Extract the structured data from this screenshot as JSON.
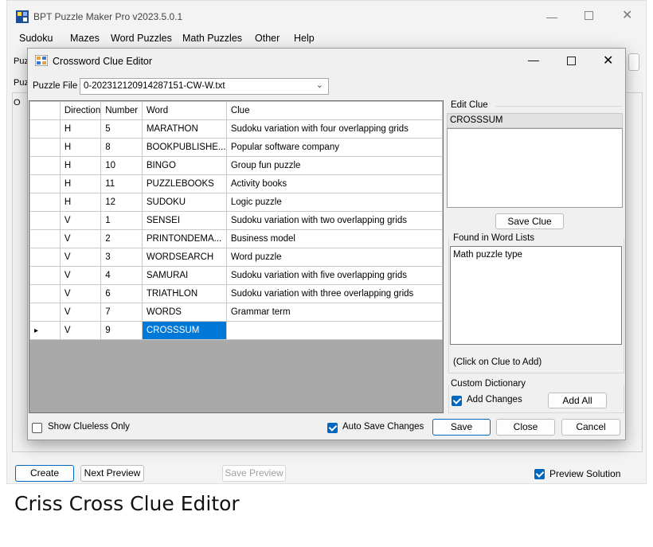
{
  "app": {
    "title": "BPT Puzzle Maker Pro v2023.5.0.1",
    "menu": [
      "Sudoku",
      "Mazes",
      "Word Puzzles",
      "Math Puzzles",
      "Other",
      "Help"
    ],
    "bg_label_1": "Puz",
    "bg_label_2": "Puz",
    "bg_label_3": "O",
    "bottom": {
      "create": "Create",
      "next_preview": "Next Preview",
      "save_preview": "Save Preview",
      "preview_solution": "Preview Solution",
      "preview_solution_checked": true
    }
  },
  "dialog": {
    "title": "Crossword Clue Editor",
    "puzzle_file_label": "Puzzle File",
    "puzzle_file_value": "0-202312120914287151-CW-W.txt",
    "columns": [
      "",
      "Direction",
      "Number",
      "Word",
      "Clue"
    ],
    "rows": [
      {
        "indicator": "",
        "direction": "H",
        "number": "5",
        "word": "MARATHON",
        "clue": "Sudoku variation with four overlapping grids"
      },
      {
        "indicator": "",
        "direction": "H",
        "number": "8",
        "word": "BOOKPUBLISHE...",
        "clue": "Popular software company"
      },
      {
        "indicator": "",
        "direction": "H",
        "number": "10",
        "word": "BINGO",
        "clue": "Group fun puzzle"
      },
      {
        "indicator": "",
        "direction": "H",
        "number": "11",
        "word": "PUZZLEBOOKS",
        "clue": "Activity books"
      },
      {
        "indicator": "",
        "direction": "H",
        "number": "12",
        "word": "SUDOKU",
        "clue": "Logic puzzle"
      },
      {
        "indicator": "",
        "direction": "V",
        "number": "1",
        "word": "SENSEI",
        "clue": "Sudoku variation with two overlapping grids"
      },
      {
        "indicator": "",
        "direction": "V",
        "number": "2",
        "word": "PRINTONDEMA...",
        "clue": "Business model"
      },
      {
        "indicator": "",
        "direction": "V",
        "number": "3",
        "word": "WORDSEARCH",
        "clue": "Word puzzle"
      },
      {
        "indicator": "",
        "direction": "V",
        "number": "4",
        "word": "SAMURAI",
        "clue": "Sudoku variation with five overlapping grids"
      },
      {
        "indicator": "",
        "direction": "V",
        "number": "6",
        "word": "TRIATHLON",
        "clue": "Sudoku variation with three overlapping grids"
      },
      {
        "indicator": "",
        "direction": "V",
        "number": "7",
        "word": "WORDS",
        "clue": "Grammar term"
      },
      {
        "indicator": "▸",
        "direction": "V",
        "number": "9",
        "word": "CROSSSUM",
        "clue": ""
      }
    ],
    "edit_clue_label": "Edit Clue",
    "edit_clue_word": "CROSSSUM",
    "edit_clue_text": "",
    "save_clue": "Save Clue",
    "found_label": "Found in Word Lists",
    "found_items": [
      "Math puzzle type"
    ],
    "click_hint": "(Click on Clue to Add)",
    "custom_dict_label": "Custom Dictionary",
    "add_changes": "Add Changes",
    "add_changes_checked": true,
    "add_all": "Add All",
    "show_clueless": "Show Clueless Only",
    "show_clueless_checked": false,
    "auto_save": "Auto Save Changes",
    "auto_save_checked": true,
    "save": "Save",
    "close": "Close",
    "cancel": "Cancel"
  },
  "caption": "Criss Cross Clue Editor",
  "colors": {
    "accent": "#0067c0",
    "selection": "#0078d7",
    "grid_empty": "#a9a9a9"
  }
}
